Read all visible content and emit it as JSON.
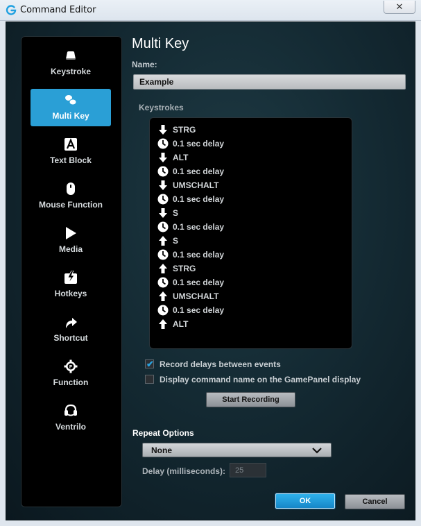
{
  "window": {
    "title": "Command Editor",
    "close_label": "✕"
  },
  "sidebar": {
    "items": [
      {
        "label": "Keystroke",
        "icon": "keycap-icon"
      },
      {
        "label": "Multi Key",
        "icon": "multi-keycap-icon",
        "active": true
      },
      {
        "label": "Text Block",
        "icon": "text-a-icon"
      },
      {
        "label": "Mouse Function",
        "icon": "mouse-icon"
      },
      {
        "label": "Media",
        "icon": "play-icon"
      },
      {
        "label": "Hotkeys",
        "icon": "hotkey-icon"
      },
      {
        "label": "Shortcut",
        "icon": "shortcut-arrow-icon"
      },
      {
        "label": "Function",
        "icon": "function-gear-icon"
      },
      {
        "label": "Ventrilo",
        "icon": "headset-icon"
      }
    ]
  },
  "main": {
    "title": "Multi Key",
    "name_label": "Name:",
    "name_value": "Example",
    "keystrokes_label": "Keystrokes",
    "keystrokes": [
      {
        "type": "down",
        "text": "STRG"
      },
      {
        "type": "delay",
        "text": "0.1 sec delay"
      },
      {
        "type": "down",
        "text": "ALT"
      },
      {
        "type": "delay",
        "text": "0.1 sec delay"
      },
      {
        "type": "down",
        "text": "UMSCHALT"
      },
      {
        "type": "delay",
        "text": "0.1 sec delay"
      },
      {
        "type": "down",
        "text": "S"
      },
      {
        "type": "delay",
        "text": "0.1 sec delay"
      },
      {
        "type": "up",
        "text": "S"
      },
      {
        "type": "delay",
        "text": "0.1 sec delay"
      },
      {
        "type": "up",
        "text": "STRG"
      },
      {
        "type": "delay",
        "text": "0.1 sec delay"
      },
      {
        "type": "up",
        "text": "UMSCHALT"
      },
      {
        "type": "delay",
        "text": "0.1 sec delay"
      },
      {
        "type": "up",
        "text": "ALT"
      }
    ],
    "record_delays_label": "Record delays between events",
    "record_delays_checked": true,
    "display_name_label": "Display command name on the GamePanel display",
    "display_name_checked": false,
    "start_recording_label": "Start Recording",
    "repeat_options_label": "Repeat Options",
    "repeat_value": "None",
    "delay_label": "Delay (milliseconds):",
    "delay_value": "25",
    "ok_label": "OK",
    "cancel_label": "Cancel"
  },
  "colors": {
    "accent": "#2a9fd6",
    "background": "#142a33"
  }
}
